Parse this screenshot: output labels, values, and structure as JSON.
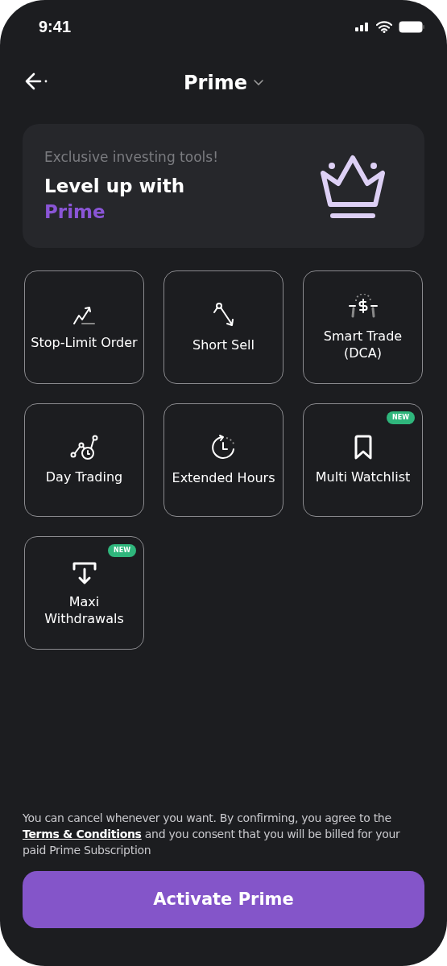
{
  "status_bar": {
    "time": "9:41"
  },
  "header": {
    "title": "Prime"
  },
  "promo": {
    "eyebrow": "Exclusive investing tools!",
    "title": "Level up with",
    "highlight": "Prime"
  },
  "features": [
    {
      "kind": "stop-limit",
      "label": "Stop-Limit Order"
    },
    {
      "kind": "short-sell",
      "label": "Short Sell"
    },
    {
      "kind": "smart-trade",
      "label": "Smart Trade (DCA)"
    },
    {
      "kind": "day-trading",
      "label": "Day Trading"
    },
    {
      "kind": "extended-hours",
      "label": "Extended Hours"
    },
    {
      "kind": "watchlist",
      "label": "Multi Watchlist",
      "badge": "NEW"
    },
    {
      "kind": "withdrawals",
      "label": "Maxi Withdrawals",
      "badge": "NEW"
    }
  ],
  "disclaimer": {
    "before": "You can cancel whenever you want. By confirming, you agree to the",
    "link": "Terms & Conditions",
    "after": "and you consent that you will be billed for your paid Prime Subscription"
  },
  "cta": {
    "label": "Activate Prime"
  }
}
